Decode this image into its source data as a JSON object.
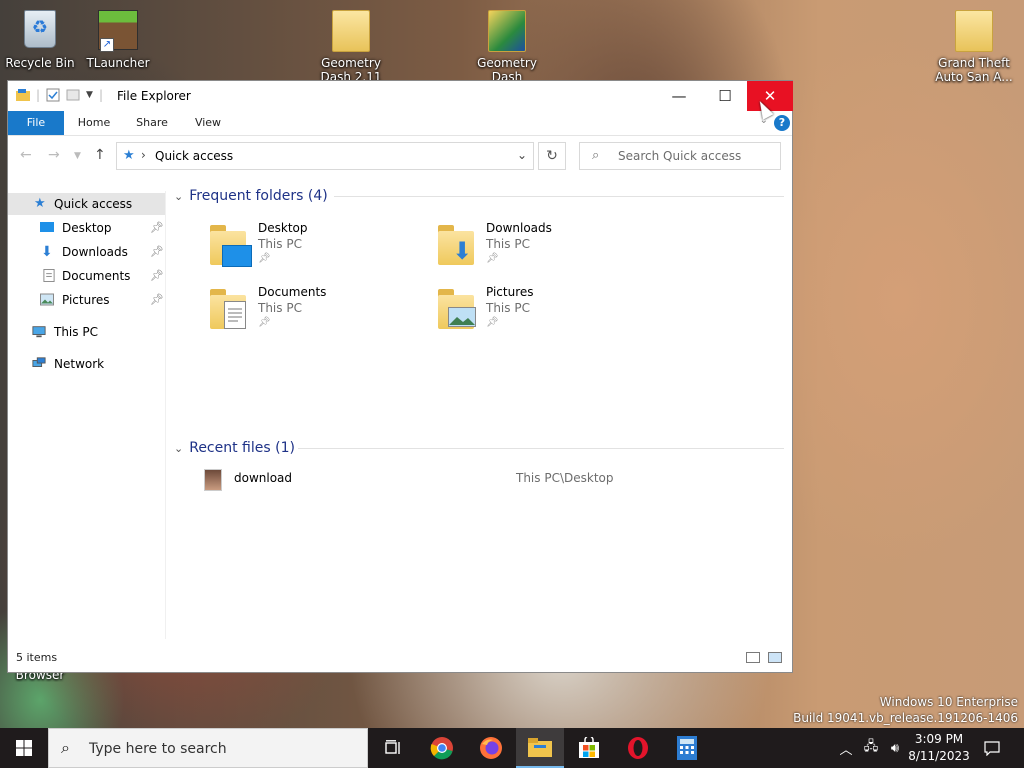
{
  "desktop": {
    "icons": [
      {
        "label": "Recycle Bin"
      },
      {
        "label": "TLauncher"
      },
      {
        "label": "Geometry Dash 2.11"
      },
      {
        "label": "Geometry Dash"
      },
      {
        "label": "Grand Theft Auto San A..."
      }
    ],
    "hidden_icon_label": "Browser",
    "watermark": {
      "line1": "Windows 10 Enterprise",
      "line2": "Build 19041.vb_release.191206-1406"
    }
  },
  "window": {
    "title": "File Explorer",
    "ribbon_tabs": [
      "File",
      "Home",
      "Share",
      "View"
    ],
    "address": {
      "path": "Quick access"
    },
    "search": {
      "placeholder": "Search Quick access"
    },
    "nav": {
      "quick_access": "Quick access",
      "items": [
        "Desktop",
        "Downloads",
        "Documents",
        "Pictures"
      ],
      "this_pc": "This PC",
      "network": "Network"
    },
    "frequent": {
      "heading": "Frequent folders (4)",
      "folders": [
        {
          "name": "Desktop",
          "location": "This PC"
        },
        {
          "name": "Downloads",
          "location": "This PC"
        },
        {
          "name": "Documents",
          "location": "This PC"
        },
        {
          "name": "Pictures",
          "location": "This PC"
        }
      ]
    },
    "recent": {
      "heading": "Recent files (1)",
      "files": [
        {
          "name": "download",
          "path": "This PC\\Desktop"
        }
      ]
    },
    "status": {
      "count": "5 items"
    }
  },
  "taskbar": {
    "search_placeholder": "Type here to search",
    "clock": {
      "time": "3:09 PM",
      "date": "8/11/2023"
    }
  },
  "colors": {
    "accent": "#1979ca",
    "close_red": "#e81123",
    "group_heading": "#1e3287"
  }
}
